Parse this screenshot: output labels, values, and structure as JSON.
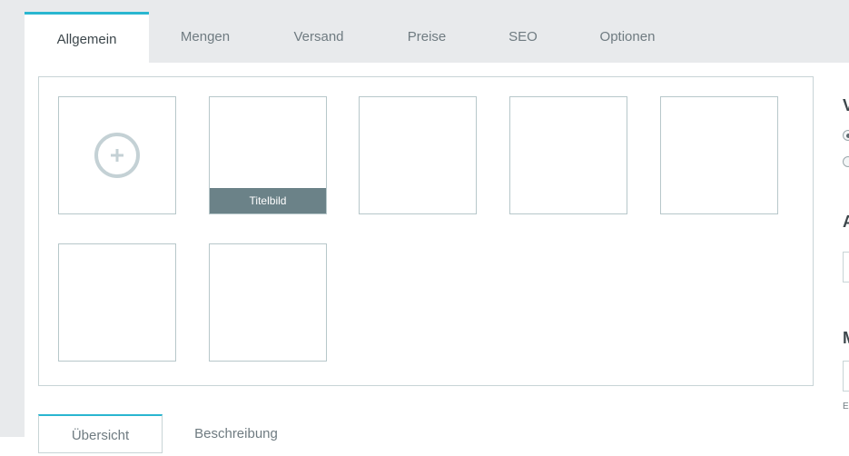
{
  "tabs": [
    {
      "label": "Allgemein",
      "active": true
    },
    {
      "label": "Mengen"
    },
    {
      "label": "Versand"
    },
    {
      "label": "Preise"
    },
    {
      "label": "SEO"
    },
    {
      "label": "Optionen"
    }
  ],
  "gallery": {
    "title_badge": "Titelbild"
  },
  "side": {
    "letters": [
      "V",
      "A",
      "M"
    ],
    "tiny": "E"
  },
  "subtabs": [
    {
      "label": "Übersicht",
      "active": true
    },
    {
      "label": "Beschreibung"
    }
  ],
  "colors": {
    "accent": "#29b6d0",
    "badge": "#6b8288"
  }
}
